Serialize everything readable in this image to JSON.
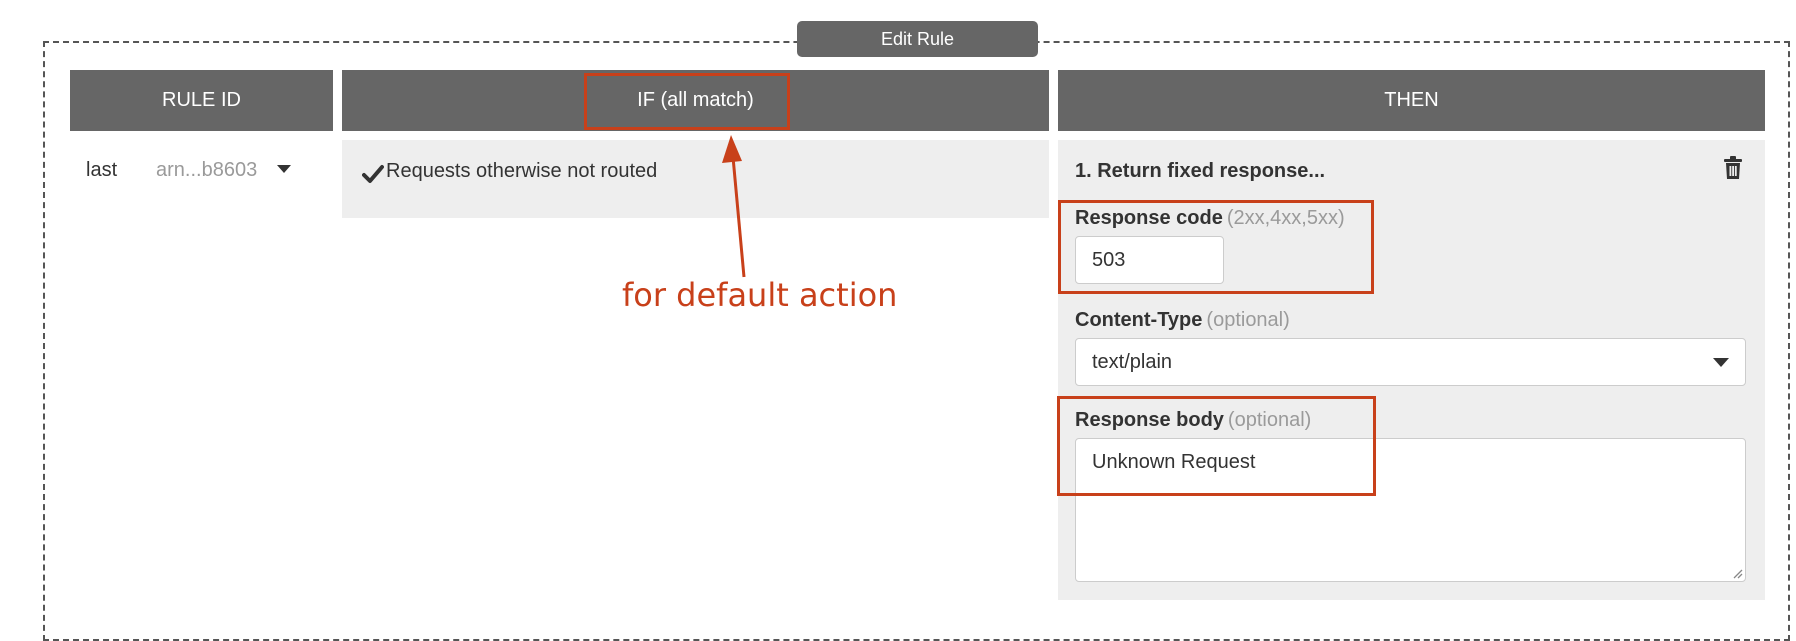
{
  "dialog": {
    "title": "Edit Rule"
  },
  "columns": {
    "rule_id": "RULE ID",
    "if": "IF (all match)",
    "then": "THEN"
  },
  "rule": {
    "priority": "last",
    "arn": "arn...b8603",
    "condition": "Requests otherwise not routed"
  },
  "action": {
    "title": "1. Return fixed response...",
    "response_code_label": "Response code",
    "response_code_hint": "(2xx,4xx,5xx)",
    "response_code_value": "503",
    "content_type_label": "Content-Type",
    "content_type_hint": "(optional)",
    "content_type_value": "text/plain",
    "response_body_label": "Response body",
    "response_body_hint": "(optional)",
    "response_body_value": "Unknown Request"
  },
  "annotation": {
    "text": "for default action",
    "color": "#c8401a"
  },
  "colors": {
    "header_bg": "#666666",
    "panel_bg": "#eeeeee",
    "muted_text": "#9a9a9a"
  },
  "icons": [
    "chevron-down-icon",
    "checkmark-icon",
    "trash-icon",
    "resize-grip-icon"
  ]
}
